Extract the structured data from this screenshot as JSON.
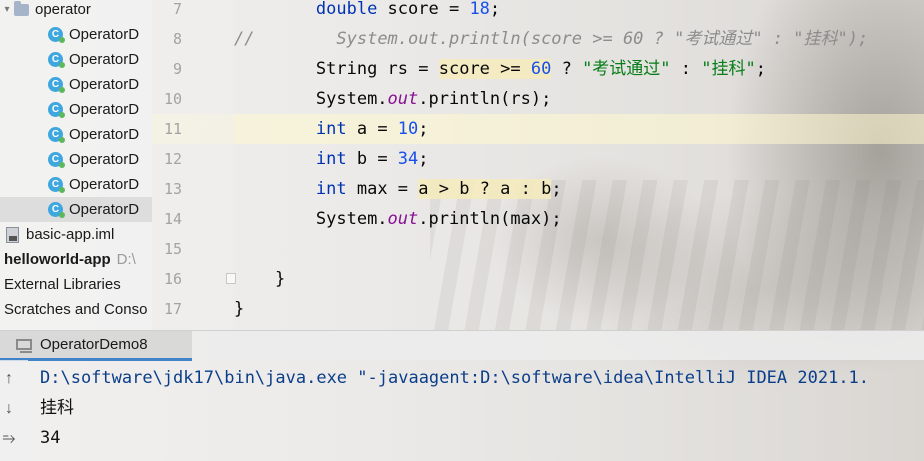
{
  "project_tree": {
    "folder": "operator",
    "class_items": [
      "OperatorD",
      "OperatorD",
      "OperatorD",
      "OperatorD",
      "OperatorD",
      "OperatorD",
      "OperatorD",
      "OperatorD"
    ],
    "iml_file": "basic-app.iml",
    "module_name": "helloworld-app",
    "module_path": "D:\\",
    "external_libraries": "External Libraries",
    "scratches": "Scratches and Conso"
  },
  "gutter": {
    "line_numbers": [
      "7",
      "8",
      "9",
      "10",
      "11",
      "12",
      "13",
      "14",
      "15",
      "16",
      "17"
    ]
  },
  "code": {
    "l7": {
      "indent": "        ",
      "kw": "double",
      "rest1": " score = ",
      "num": "18",
      "rest2": ";"
    },
    "l8": {
      "prefix": "//",
      "spaces": "        ",
      "comment": "System.out.println(score >= 60 ? \"考试通过\" : \"挂科\");"
    },
    "l9": {
      "indent": "        ",
      "type": "String",
      "rest1": " rs = ",
      "hl_a": "score >= ",
      "hl_num": "60",
      "rest2": " ? ",
      "str1": "\"考试通过\"",
      "rest3": " : ",
      "str2": "\"挂科\"",
      "rest4": ";"
    },
    "l10": {
      "indent": "        ",
      "cls": "System.",
      "field": "out",
      "rest": ".println(rs);"
    },
    "l11": {
      "indent": "        ",
      "kw": "int",
      "rest1": " a = ",
      "num": "10",
      "rest2": ";"
    },
    "l12": {
      "indent": "        ",
      "kw": "int",
      "rest1": " b = ",
      "num": "34",
      "rest2": ";"
    },
    "l13": {
      "indent": "        ",
      "kw": "int",
      "rest1": " max = ",
      "hl": "a > b ? a : b",
      "rest2": ";"
    },
    "l14": {
      "indent": "        ",
      "cls": "System.",
      "field": "out",
      "rest": ".println(max);"
    },
    "l16": {
      "indent": "    ",
      "brace": "}"
    },
    "l17": {
      "brace": "}"
    }
  },
  "run_panel": {
    "tab_label": "OperatorDemo8",
    "console_lines": [
      "D:\\software\\jdk17\\bin\\java.exe \"-javaagent:D:\\software\\idea\\IntelliJ IDEA 2021.1.",
      "挂科",
      "34"
    ],
    "toolbar_icons": [
      "arrow-up-icon",
      "arrow-down-icon",
      "wrap-icon"
    ]
  }
}
